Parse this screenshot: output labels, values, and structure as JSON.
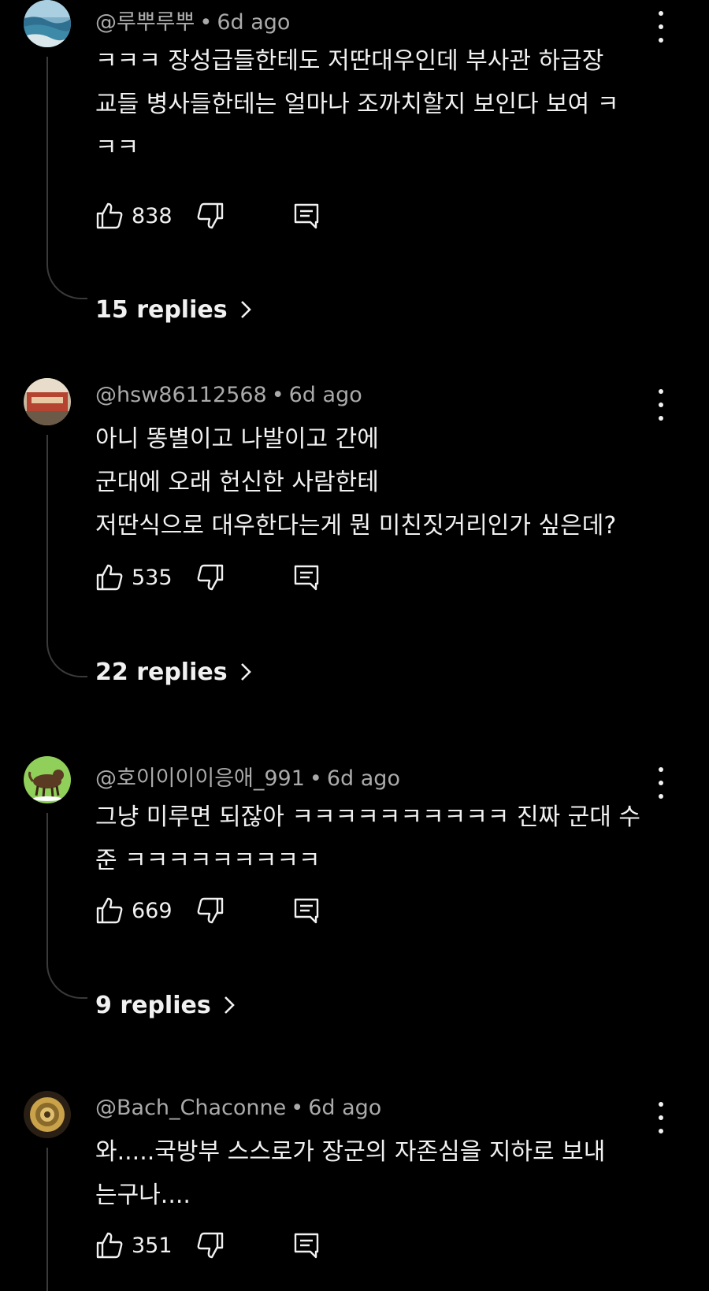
{
  "comments": [
    {
      "author": "@루뿌루뿌",
      "time": "6d ago",
      "lines": [
        "ㅋㅋㅋ 장성급들한테도 저딴대우인데 부사관 하급장",
        "교들 병사들한테는 얼마나 조까치할지 보인다 보여 ㅋ",
        "ㅋㅋ"
      ],
      "likes": "838",
      "replies": "15 replies",
      "avatar_color": "#5f8fa8"
    },
    {
      "author": "@hsw86112568",
      "time": "6d ago",
      "lines": [
        "아니 똥별이고 나발이고 간에",
        "군대에 오래 헌신한 사람한테",
        "저딴식으로 대우한다는게 뭔 미친짓거리인가 싶은데?"
      ],
      "likes": "535",
      "replies": "22 replies",
      "avatar_color": "#b54a3a"
    },
    {
      "author": "@호이이이이응애_991",
      "time": "6d ago",
      "lines": [
        "그냥 미루면 되잖아 ㅋㅋㅋㅋㅋㅋㅋㅋㅋㅋ 진짜 군대 수",
        "준 ㅋㅋㅋㅋㅋㅋㅋㅋㅋ"
      ],
      "likes": "669",
      "replies": "9 replies",
      "avatar_color": "#8bc34a"
    },
    {
      "author": "@Bach_Chaconne",
      "time": "6d ago",
      "lines": [
        "와.....국방부 스스로가 장군의 자존심을 지하로 보내",
        "는구나...."
      ],
      "likes": "351",
      "avatar_color": "#7a5a2a"
    }
  ],
  "icons": {
    "like": "thumbs-up-icon",
    "dislike": "thumbs-down-icon",
    "reply": "comment-reply-icon",
    "menu": "more-vertical-icon",
    "chevron": "chevron-right-icon"
  }
}
